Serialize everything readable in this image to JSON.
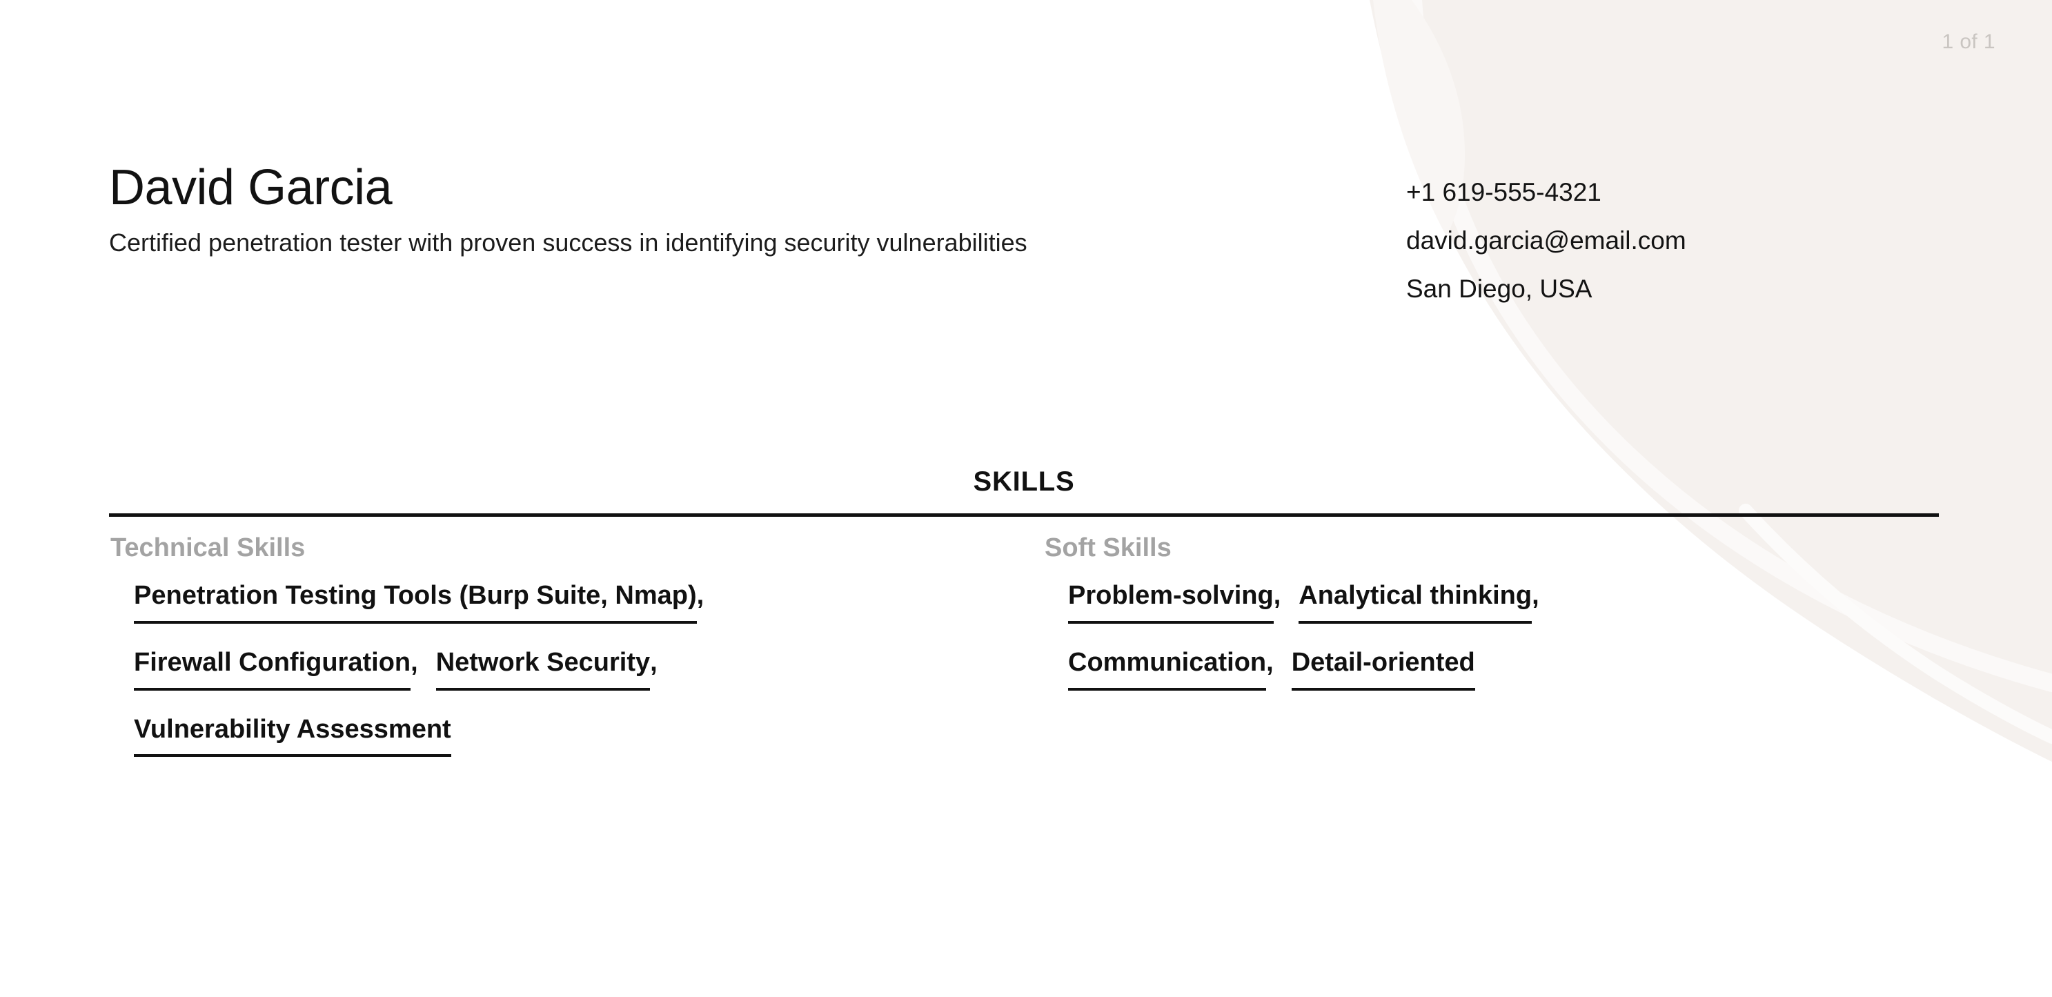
{
  "page_indicator": "1 of 1",
  "theme": {
    "background": "#ffffff",
    "text": "#111111",
    "muted_label": "#a3a3a3",
    "page_indicator_color": "#c9c5c1",
    "decor_blob": "#f5f1ee",
    "decor_swoosh": "#fbf9f8",
    "rule": "#111111"
  },
  "header": {
    "name": "David Garcia",
    "summary": "Certified penetration tester with proven success in identifying security vulnerabilities",
    "contact": {
      "phone": "+1 619-555-4321",
      "email": "david.garcia@email.com",
      "location": "San Diego, USA"
    }
  },
  "sections": [
    {
      "title": "SKILLS",
      "columns": [
        {
          "category": "Technical Skills",
          "rows": [
            [
              {
                "name": "Penetration Testing Tools (Burp Suite, Nmap)",
                "separator": ","
              }
            ],
            [
              {
                "name": "Firewall Configuration",
                "separator": ","
              },
              {
                "name": "Network Security",
                "separator": ","
              }
            ],
            [
              {
                "name": "Vulnerability Assessment",
                "separator": ""
              }
            ]
          ]
        },
        {
          "category": "Soft Skills",
          "rows": [
            [
              {
                "name": "Problem-solving",
                "separator": ","
              },
              {
                "name": "Analytical thinking",
                "separator": ","
              }
            ],
            [
              {
                "name": "Communication",
                "separator": ","
              },
              {
                "name": "Detail-oriented",
                "separator": ""
              }
            ]
          ]
        }
      ]
    }
  ]
}
